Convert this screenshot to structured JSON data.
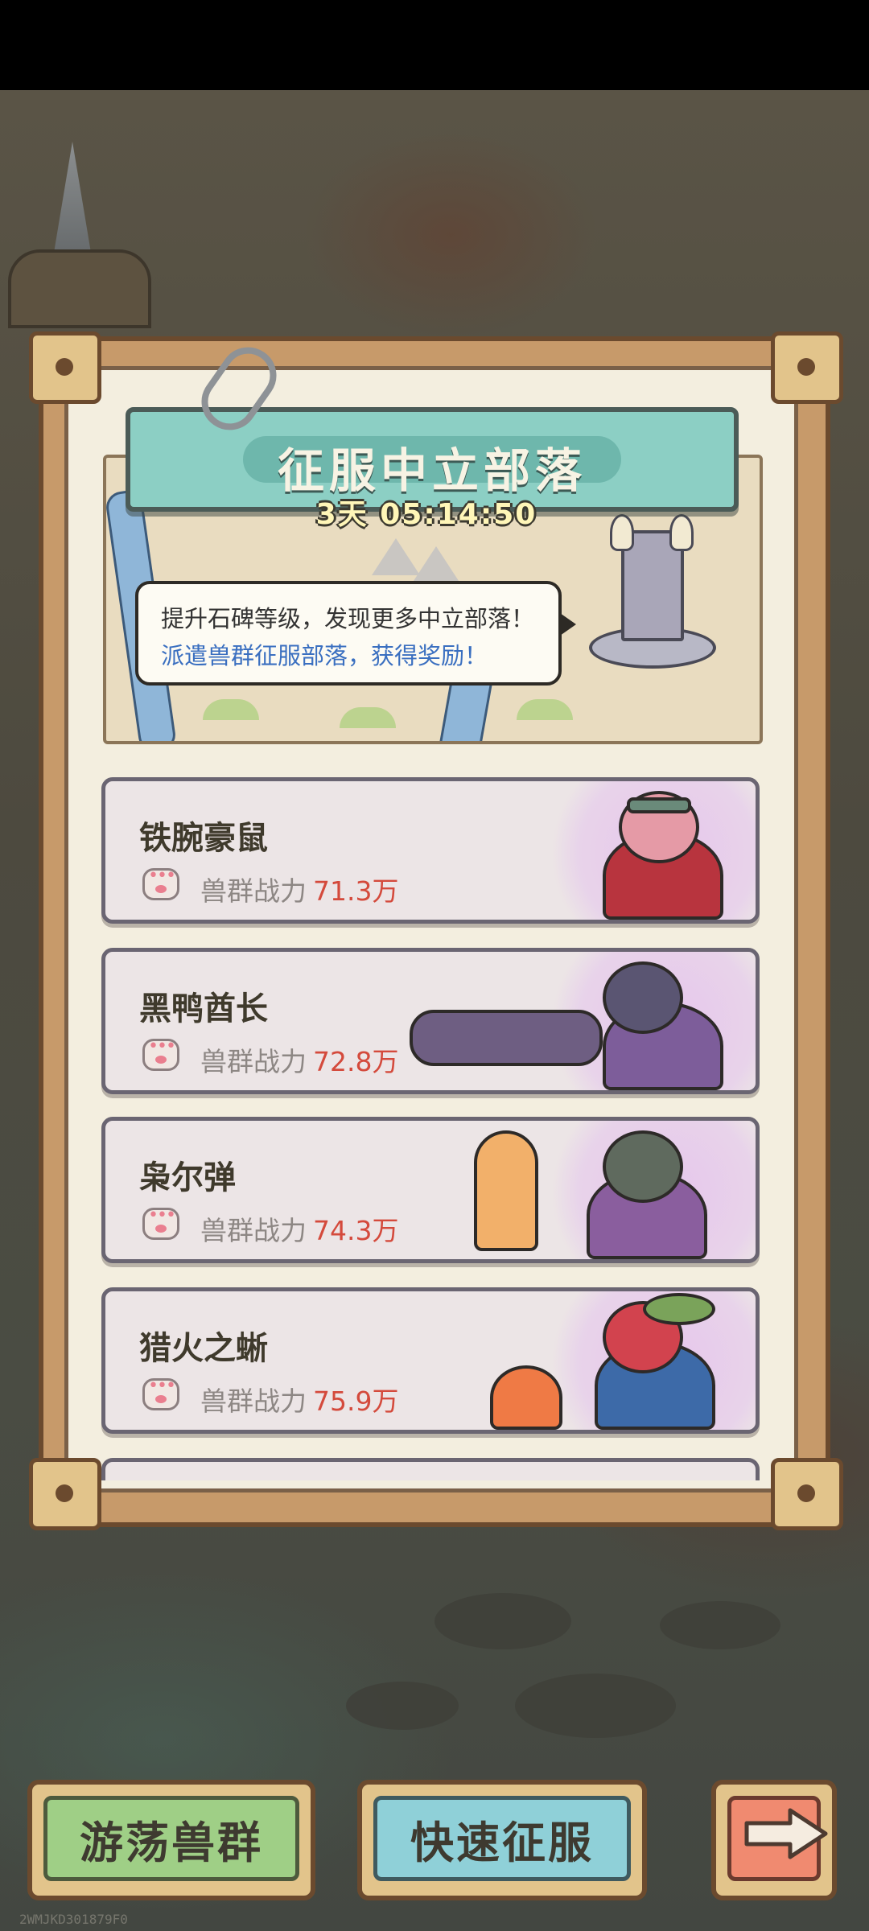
{
  "event": {
    "title": "征服中立部落",
    "countdown": "3天 05:14:50",
    "tip_line1": "提升石碑等级，发现更多中立部落！",
    "tip_line2": "派遣兽群征服部落，获得奖励！"
  },
  "tribes": [
    {
      "name": "铁腕豪鼠",
      "power_label": "兽群战力",
      "power_value": "71.3万",
      "icon": "paw-icon"
    },
    {
      "name": "黑鸭酋长",
      "power_label": "兽群战力",
      "power_value": "72.8万",
      "icon": "paw-icon"
    },
    {
      "name": "枭尔弹",
      "power_label": "兽群战力",
      "power_value": "74.3万",
      "icon": "paw-icon"
    },
    {
      "name": "猎火之蜥",
      "power_label": "兽群战力",
      "power_value": "75.9万",
      "icon": "paw-icon"
    }
  ],
  "buttons": {
    "roaming_herd": "游荡兽群",
    "quick_conquer": "快速征服",
    "next_icon": "arrow-right-icon"
  },
  "watermark": "2WMJKD301879F0",
  "colors": {
    "banner": "#8ccfc4",
    "power_value": "#d44a3c",
    "tip_highlight": "#3a6fc0",
    "roaming_button": "#9fcf86",
    "quick_button": "#8fd0d8",
    "next_button": "#f08a70"
  }
}
